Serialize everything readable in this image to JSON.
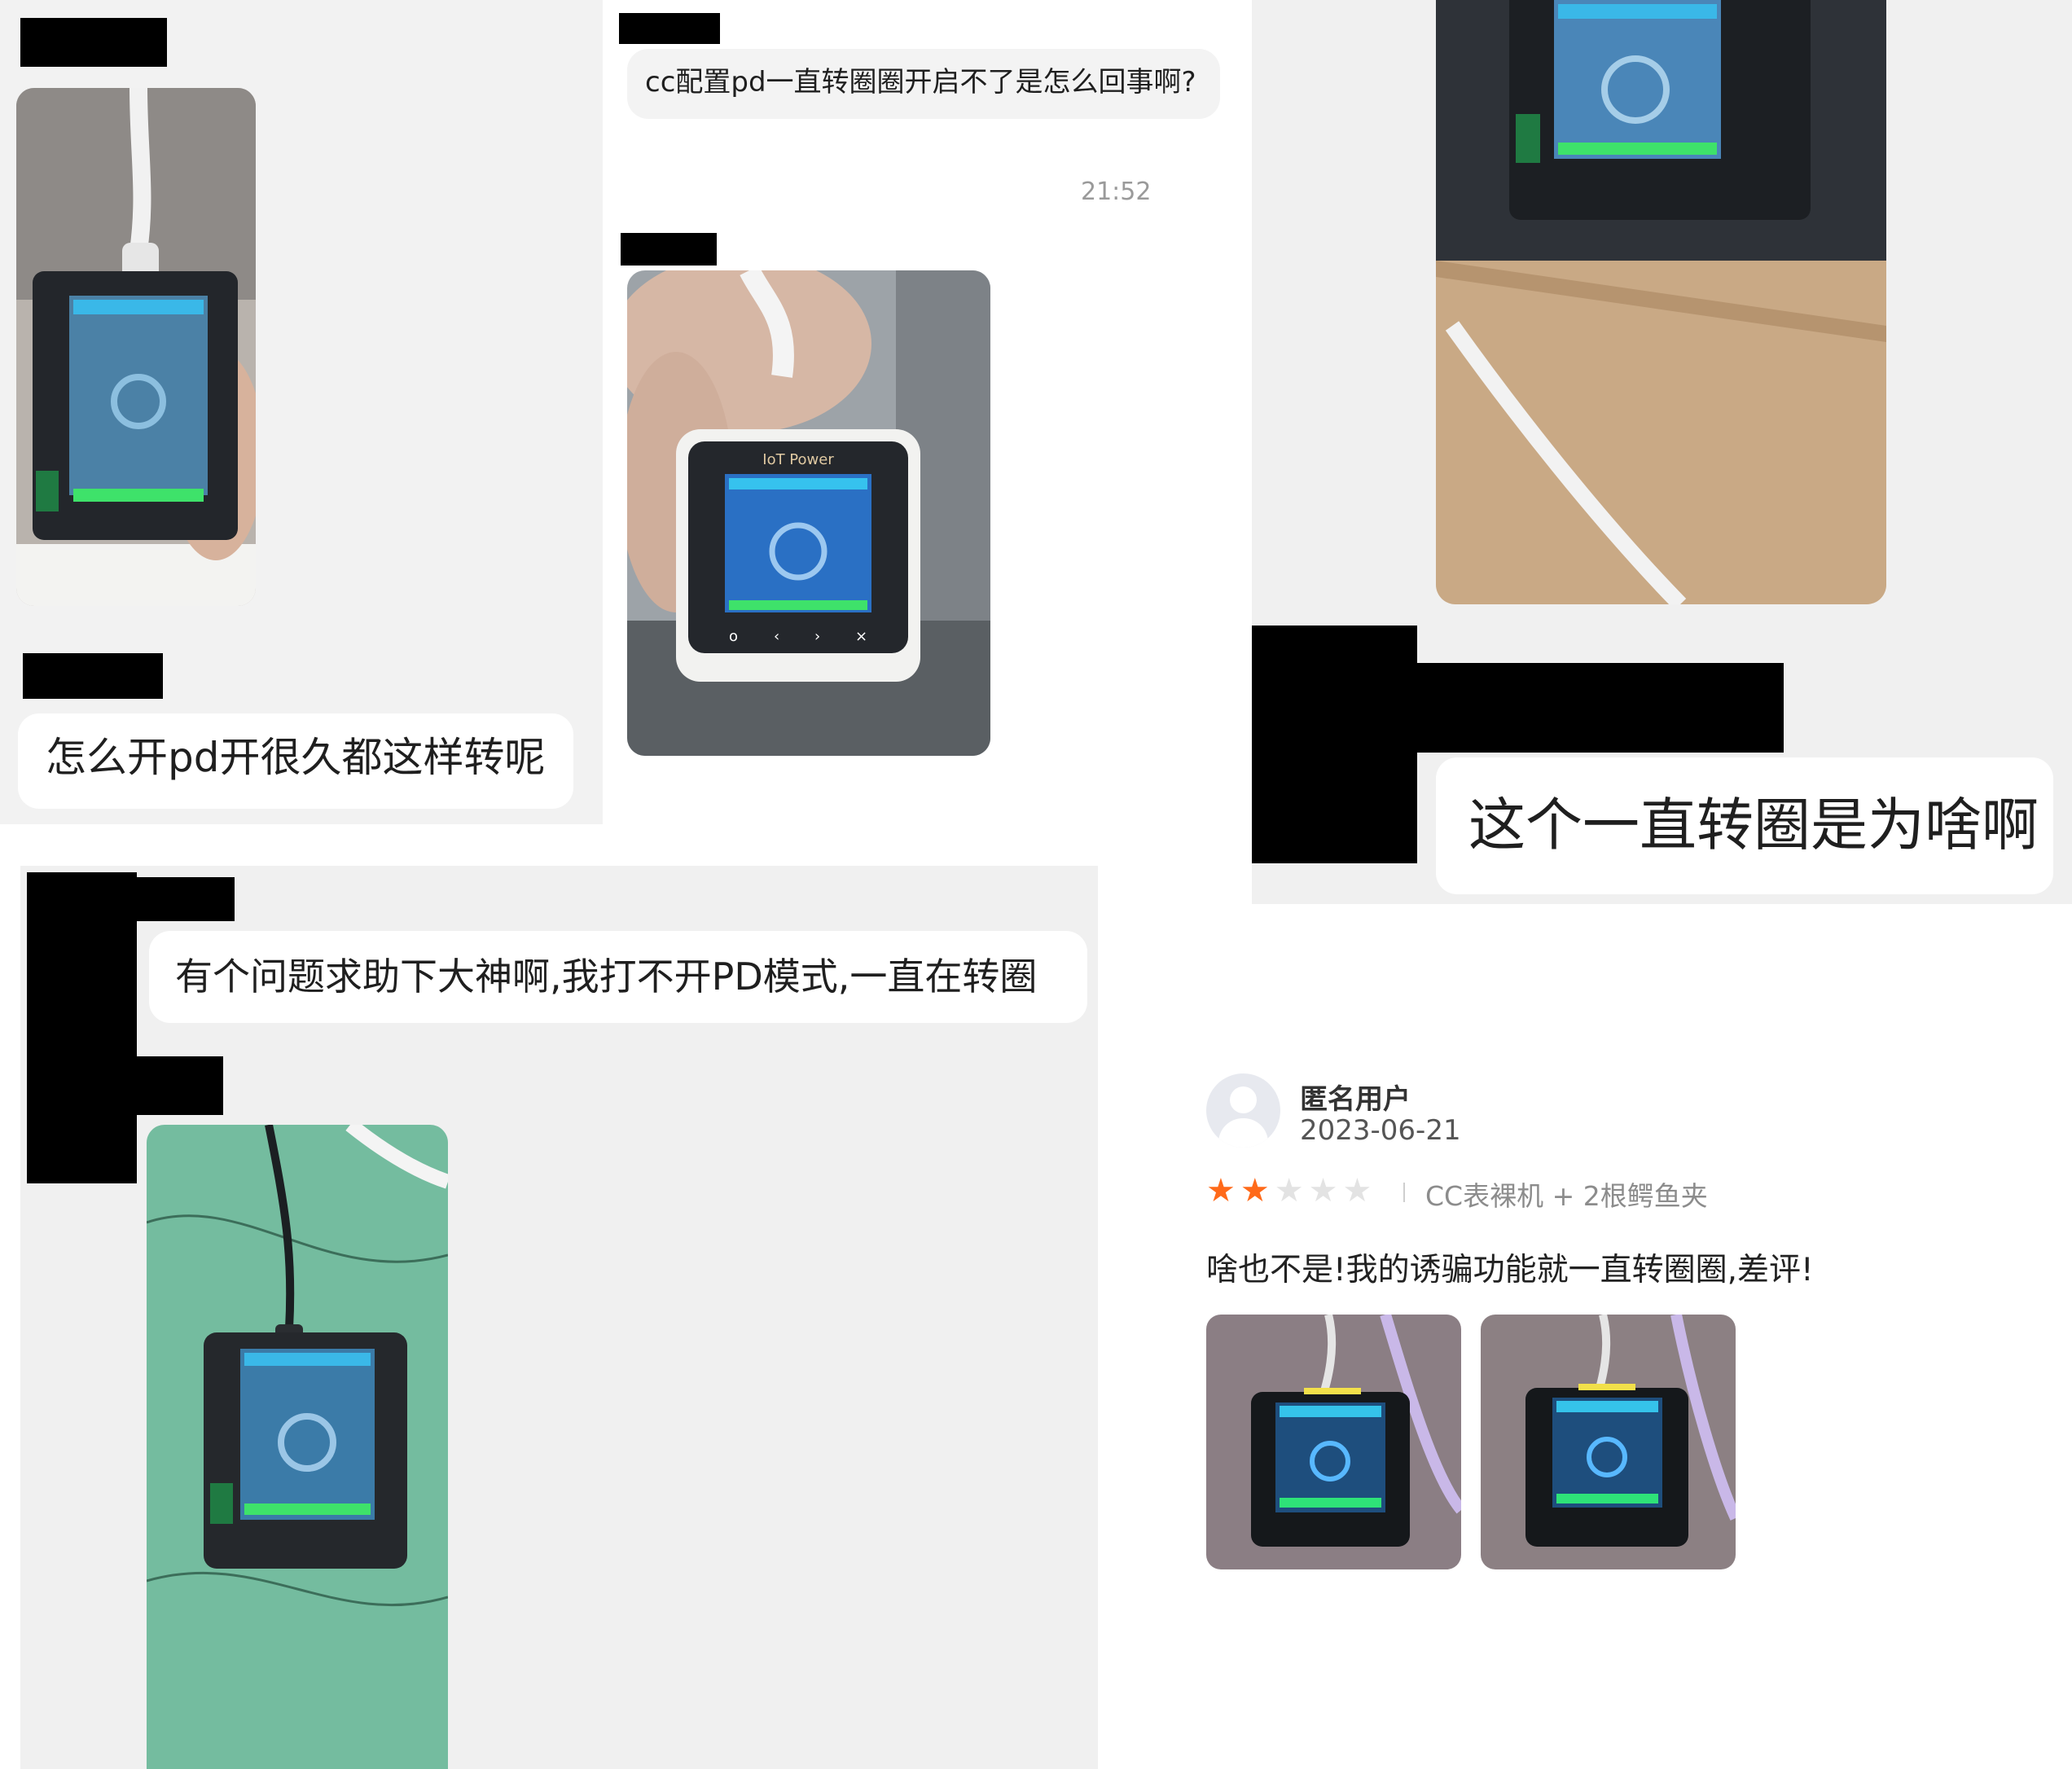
{
  "chat1": {
    "message": "怎么开pd开很久都这样转呢"
  },
  "chat2": {
    "message": "cc配置pd一直转圈圈开启不了是怎么回事啊?",
    "time": "21:52",
    "device_brand": "IoT Power"
  },
  "chat3": {
    "message": "这个一直转圈是为啥啊"
  },
  "chat4": {
    "message": "有个问题求助下大神啊,我打不开PD模式,一直在转圈"
  },
  "review": {
    "user_name": "匿名用户",
    "date": "2023-06-21",
    "rating": 2,
    "rating_max": 5,
    "variant": "CC表裸机 + 2根鳄鱼夹",
    "text": "啥也不是!我的诱骗功能就一直转圈圈,差评!",
    "star_color_on": "#ff6a1a",
    "star_color_off": "#e3e3e3"
  }
}
